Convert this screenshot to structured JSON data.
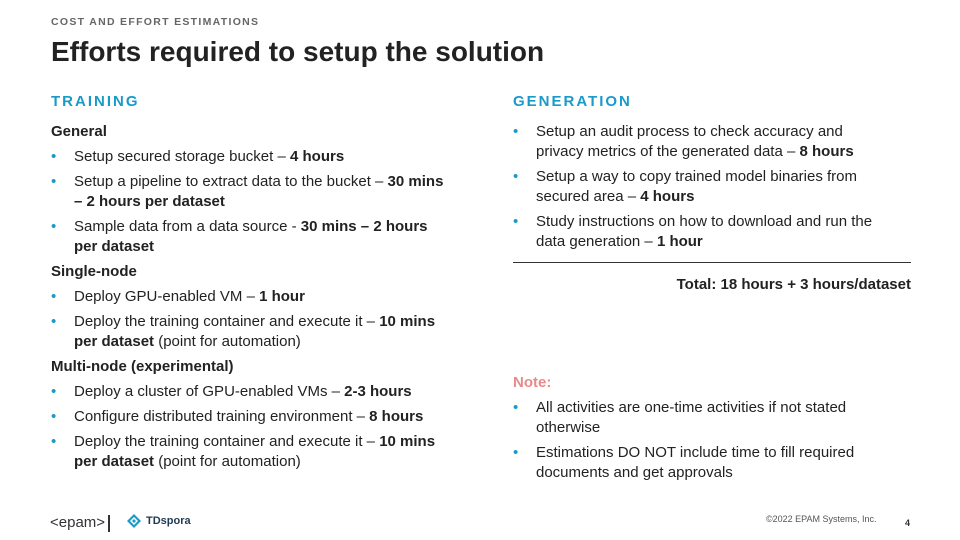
{
  "header": {
    "section_tag": "COST AND EFFORT ESTIMATIONS",
    "title": "Efforts required to setup the solution"
  },
  "training": {
    "heading": "TRAINING",
    "groups": [
      {
        "title": "General",
        "items": [
          {
            "text": "Setup secured storage bucket – ",
            "bold": "4 hours",
            "after": ""
          },
          {
            "text": "Setup a pipeline to extract data to the bucket – ",
            "bold": "30 mins – 2 hours per dataset",
            "after": ""
          },
          {
            "text": "Sample data from a data source - ",
            "bold": "30 mins – 2 hours per dataset",
            "after": ""
          }
        ]
      },
      {
        "title": "Single-node",
        "items": [
          {
            "text": "Deploy GPU-enabled VM – ",
            "bold": "1 hour",
            "after": ""
          },
          {
            "text": "Deploy the training container and execute it – ",
            "bold": "10 mins per dataset",
            "after": " (point for automation)"
          }
        ]
      },
      {
        "title": "Multi-node (experimental)",
        "items": [
          {
            "text": "Deploy a cluster of GPU-enabled VMs – ",
            "bold": "2-3 hours",
            "after": ""
          },
          {
            "text": "Configure distributed training environment – ",
            "bold": "8 hours",
            "after": ""
          },
          {
            "text": "Deploy the training container and execute it – ",
            "bold": "10 mins per dataset",
            "after": " (point for automation)"
          }
        ]
      }
    ]
  },
  "generation": {
    "heading": "GENERATION",
    "items": [
      {
        "text": "Setup an audit process to check accuracy and privacy metrics of the generated data – ",
        "bold": "8 hours",
        "after": ""
      },
      {
        "text": "Setup a way to copy trained model binaries from secured area – ",
        "bold": "4 hours",
        "after": ""
      },
      {
        "text": "Study instructions on how to download and run the data generation – ",
        "bold": "1 hour",
        "after": ""
      }
    ],
    "total": "Total: 18 hours + 3 hours/dataset"
  },
  "note": {
    "label": "Note:",
    "items": [
      "All activities are one-time activities if not stated otherwise",
      "Estimations DO NOT include time to fill required documents and get approvals"
    ]
  },
  "footer": {
    "logo_epam": "<epam>",
    "logo_partner": "TDspora",
    "copyright": "©2022 EPAM Systems, Inc.",
    "page_number": "4"
  },
  "colors": {
    "accent": "#1a9ac9",
    "note": "#e98a8a",
    "text": "#222222"
  },
  "bullet_glyph": "•"
}
